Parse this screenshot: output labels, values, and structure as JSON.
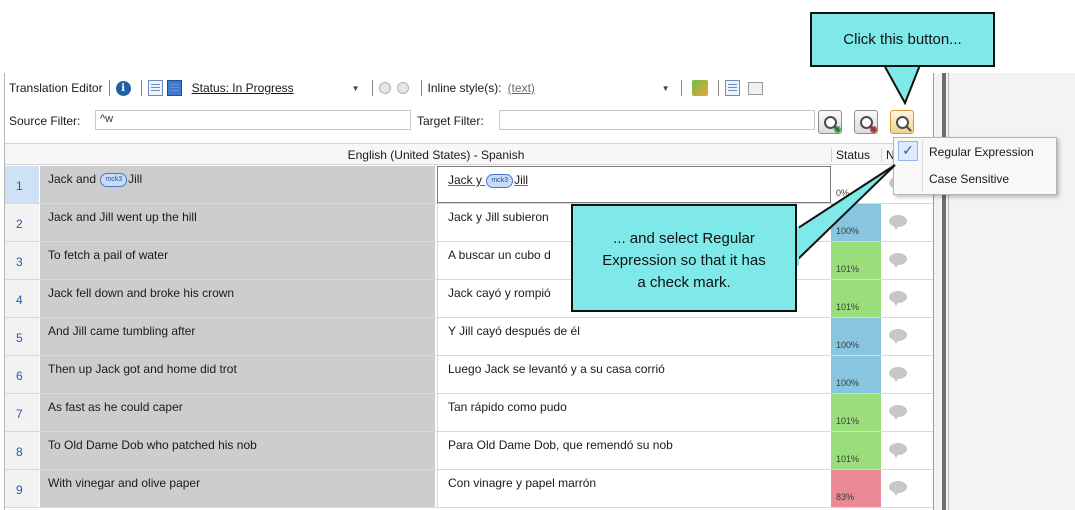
{
  "toolbar": {
    "title": "Translation Editor",
    "status_label": "Status: In Progress",
    "inline_style_label": "Inline style(s):",
    "inline_style_value": "(text)"
  },
  "filters": {
    "source_label": "Source Filter:",
    "source_value": "^w",
    "target_label": "Target Filter:",
    "target_value": ""
  },
  "table": {
    "header_language": "English (United States) - Spanish",
    "header_status": "Status",
    "header_n": "N",
    "rows": [
      {
        "num": "1",
        "source_pre": "Jack and ",
        "source_tag": "mck3",
        "source_post": "Jill",
        "target_pre": "Jack y ",
        "target_tag": "mck3",
        "target_post": "Jill",
        "status": "0%",
        "status_color": "#ffffff"
      },
      {
        "num": "2",
        "source": "Jack and Jill went up the hill",
        "target": "Jack y Jill subieron",
        "status": "100%",
        "status_color": "#87c6de"
      },
      {
        "num": "3",
        "source": "To fetch a pail of water",
        "target": "A buscar un cubo d",
        "status": "101%",
        "status_color": "#9ade7c"
      },
      {
        "num": "4",
        "source": "Jack fell down and broke his crown",
        "target": "Jack cayó y rompió",
        "status": "101%",
        "status_color": "#9ade7c"
      },
      {
        "num": "5",
        "source": "And Jill came tumbling after",
        "target": "Y Jill cayó después de él",
        "status": "100%",
        "status_color": "#87c6de"
      },
      {
        "num": "6",
        "source": "Then up Jack got and home did trot",
        "target": "Luego Jack se levantó y a su casa corrió",
        "status": "100%",
        "status_color": "#87c6de"
      },
      {
        "num": "7",
        "source": "As fast as he could caper",
        "target": "Tan rápido como pudo",
        "status": "101%",
        "status_color": "#9ade7c"
      },
      {
        "num": "8",
        "source": "To Old Dame Dob who patched his nob",
        "target": "Para Old Dame Dob, que remendó su nob",
        "status": "101%",
        "status_color": "#9ade7c"
      },
      {
        "num": "9",
        "source": "With vinegar and olive paper",
        "target": "Con vinagre y papel marrón",
        "status": "83%",
        "status_color": "#e98a96"
      }
    ]
  },
  "menu": {
    "regular_expression": "Regular Expression",
    "case_sensitive": "Case Sensitive",
    "check_mark": "✓"
  },
  "callouts": {
    "top": "Click this button...",
    "middle_line1": "... and select Regular",
    "middle_line2": "Expression so that it has",
    "middle_line3": "a check mark."
  },
  "icons": [
    "info-icon",
    "document-icon",
    "document-blue-icon",
    "circle-icon",
    "tag-insert-icon",
    "grid-icon",
    "search-green-icon",
    "search-red-icon",
    "search-options-icon",
    "comment-icon"
  ]
}
